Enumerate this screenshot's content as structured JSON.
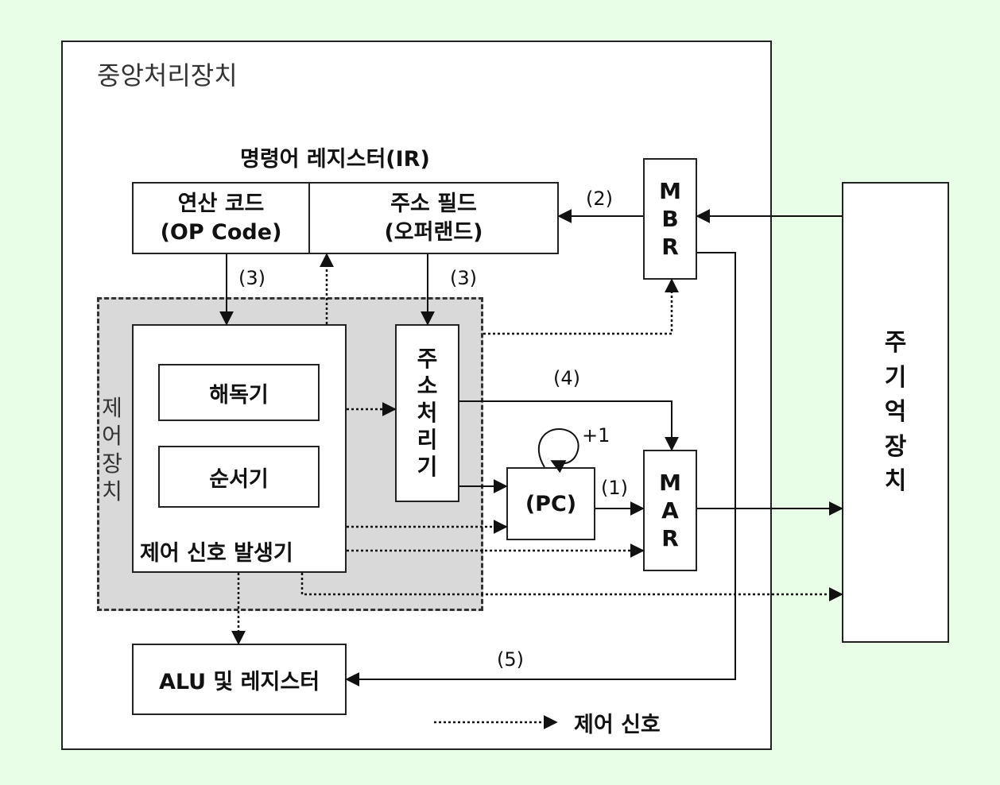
{
  "cpu": {
    "title": "중앙처리장치"
  },
  "ir": {
    "title": "명령어 레지스터(IR)",
    "opcode": {
      "line1": "연산 코드",
      "line2": "(OP Code)"
    },
    "address_field": {
      "line1": "주소 필드",
      "line2": "(오퍼랜드)"
    }
  },
  "mbr": {
    "label": "MBR",
    "chars": [
      "M",
      "B",
      "R"
    ]
  },
  "mar": {
    "label": "MAR",
    "chars": [
      "M",
      "A",
      "R"
    ]
  },
  "memory": {
    "label": "주기억장치",
    "chars": [
      "주",
      "기",
      "억",
      "장",
      "치"
    ]
  },
  "control_unit": {
    "label": "제어장치",
    "chars": [
      "제",
      "어",
      "장",
      "치"
    ],
    "decoder": "해독기",
    "sequencer": "순서기",
    "signal_generator": "제어 신호 발생기"
  },
  "address_processor": {
    "label": "주소처리기",
    "chars": [
      "주",
      "소",
      "처",
      "리",
      "기"
    ]
  },
  "pc": {
    "label": "(PC)",
    "increment": "+1"
  },
  "alu": {
    "label": "ALU 및 레지스터"
  },
  "steps": [
    "(1)",
    "(2)",
    "(3)",
    "(3)",
    "(4)",
    "(5)"
  ],
  "legend": {
    "label": "제어 신호"
  }
}
